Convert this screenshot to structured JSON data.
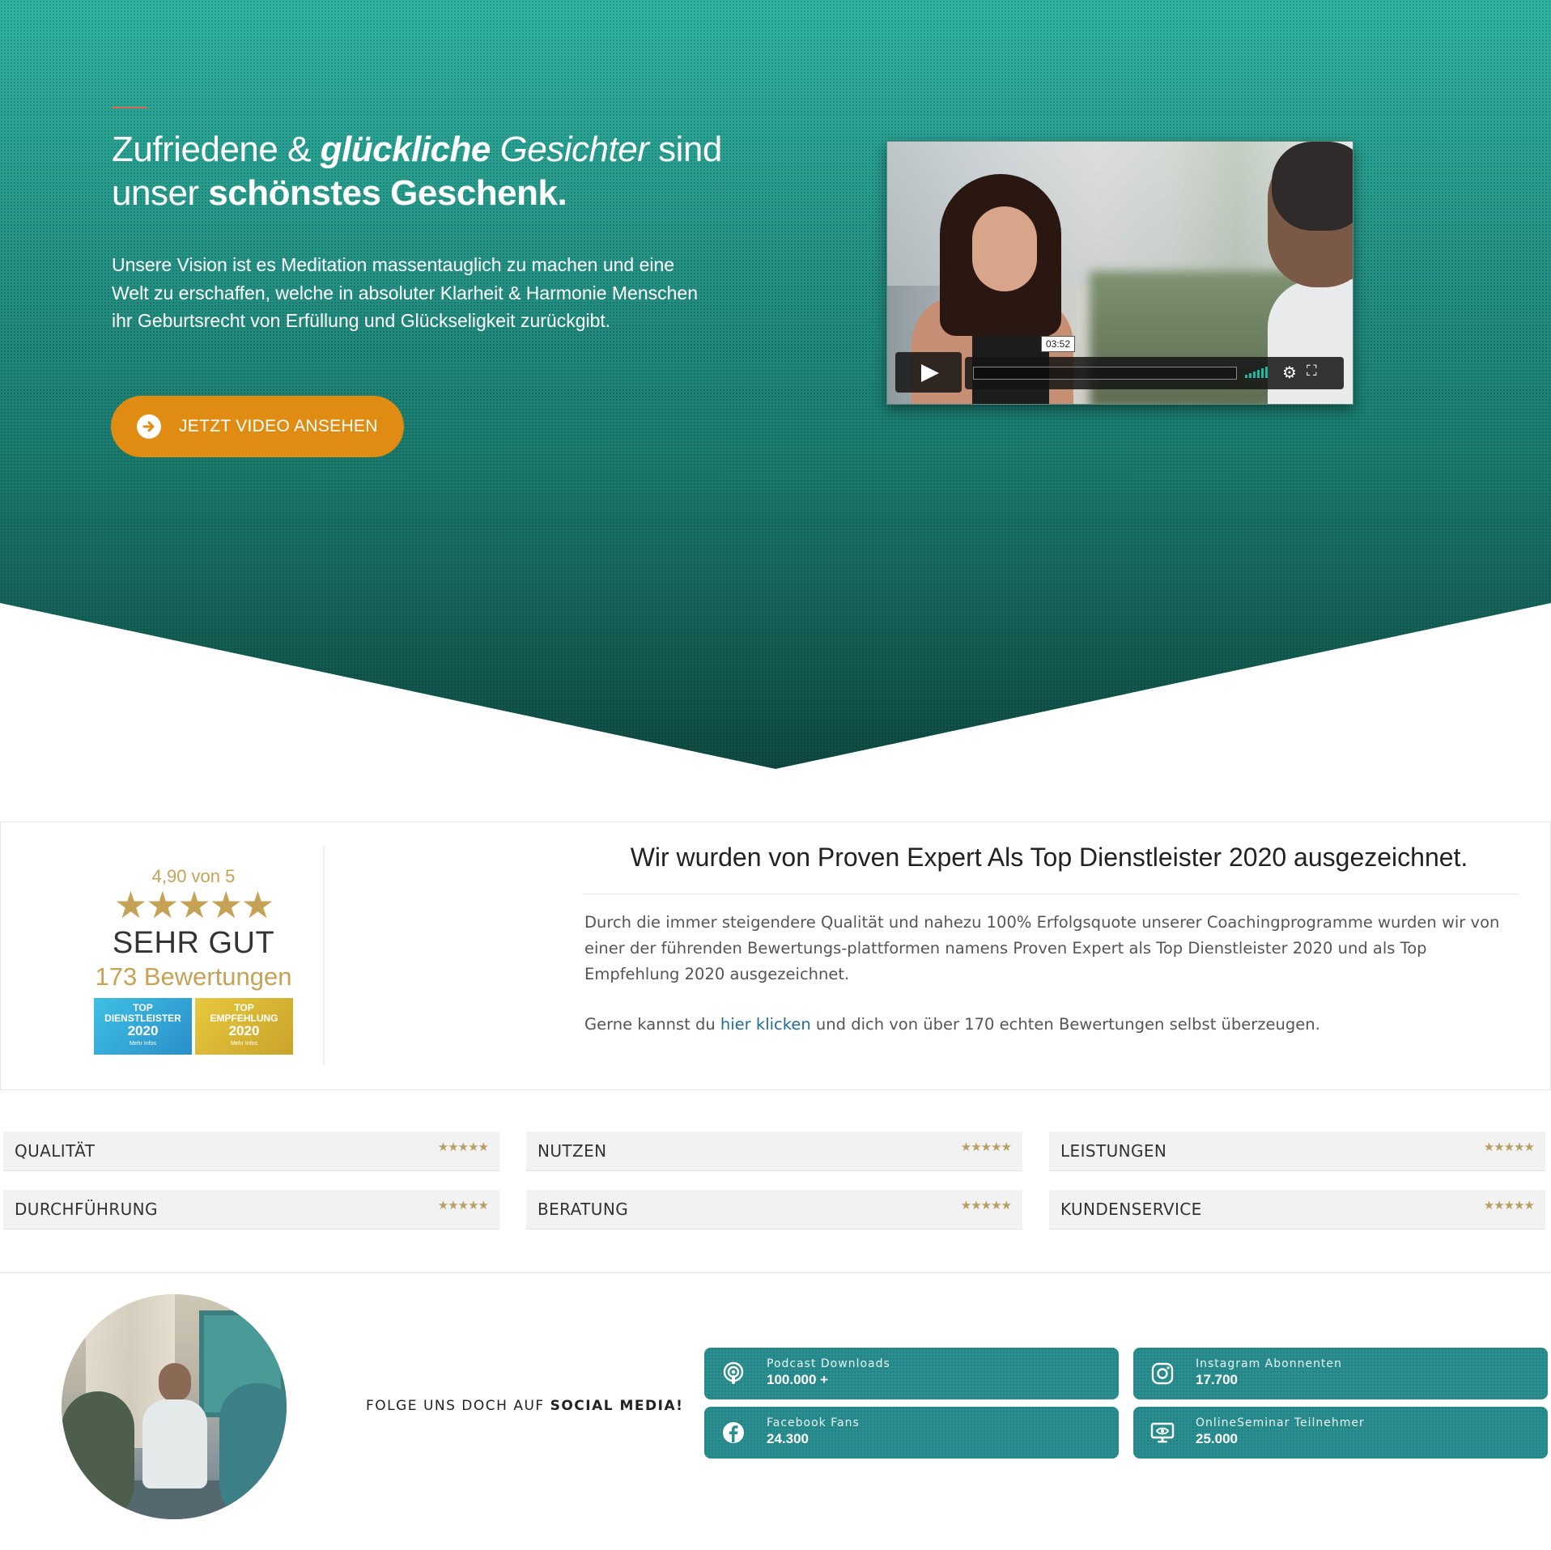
{
  "hero": {
    "title_p1": "Zufriedene & ",
    "title_p2": "glückliche",
    "title_p3": " Gesichter",
    "title_p4": " sind",
    "title_p5": "unser ",
    "title_p6": "schönstes Geschenk.",
    "text": "Unsere Vision ist es Meditation massentauglich zu machen und eine Welt zu erschaffen, welche in absoluter Klarheit & Harmonie Menschen ihr Geburtsrecht von Erfüllung und Glückseligkeit zurückgibt.",
    "cta_label": "JETZT VIDEO ANSEHEN",
    "cta_icon": "arrow-circle-right-icon"
  },
  "video": {
    "time": "03:52"
  },
  "proven_expert": {
    "score": "4,90 von 5",
    "stars": "★★★★★",
    "grade": "SEHR GUT",
    "count": "173 Bewertungen",
    "badge1_top": "TOP",
    "badge1_mid": "DIENSTLEISTER",
    "badge1_year": "2020",
    "badge1_more": "Mehr Infos",
    "badge2_top": "TOP",
    "badge2_mid": "EMPFEHLUNG",
    "badge2_year": "2020",
    "badge2_more": "Mehr Infos",
    "heading": "Wir wurden von Proven Expert Als Top Dienstleister 2020 ausgezeichnet.",
    "paragraph1": "Durch die immer steigendere Qualität und nahezu 100% Erfolgsquote unserer Coachingprogramme wurden wir von einer der führenden Bewertungs-plattformen namens Proven Expert als Top Dienstleister 2020 und als Top Empfehlung 2020 ausgezeichnet.",
    "paragraph2_pre": "Gerne kannst du ",
    "paragraph2_link": "hier klicken",
    "paragraph2_post": " und dich von über 170 echten Bewertungen selbst überzeugen."
  },
  "ratings": [
    {
      "label": "QUALITÄT",
      "stars": "★★★★★",
      "value": 5
    },
    {
      "label": "NUTZEN",
      "stars": "★★★★★",
      "value": 4.8
    },
    {
      "label": "LEISTUNGEN",
      "stars": "★★★★★",
      "value": 4.8
    },
    {
      "label": "DURCHFÜHRUNG",
      "stars": "★★★★★",
      "value": 5
    },
    {
      "label": "BERATUNG",
      "stars": "★★★★★",
      "value": 4.8
    },
    {
      "label": "KUNDENSERVICE",
      "stars": "★★★★★",
      "value": 5
    }
  ],
  "social": {
    "follow_pre": "FOLGE UNS DOCH AUF ",
    "follow_bold": "SOCIAL MEDIA!",
    "stats": [
      {
        "label": "Podcast Downloads",
        "value": "100.000 +",
        "icon": "podcast-icon"
      },
      {
        "label": "Instagram Abonnenten",
        "value": "17.700",
        "icon": "instagram-icon"
      },
      {
        "label": "Facebook Fans",
        "value": "24.300",
        "icon": "facebook-icon"
      },
      {
        "label": "OnlineSeminar Teilnehmer",
        "value": "25.000",
        "icon": "webinar-icon"
      }
    ]
  },
  "colors": {
    "hero_teal": "#249184",
    "cta_orange": "#e08c12",
    "star_gold": "#c5a255",
    "stat_teal": "#2a8f90",
    "link_blue": "#1f6b9a"
  }
}
